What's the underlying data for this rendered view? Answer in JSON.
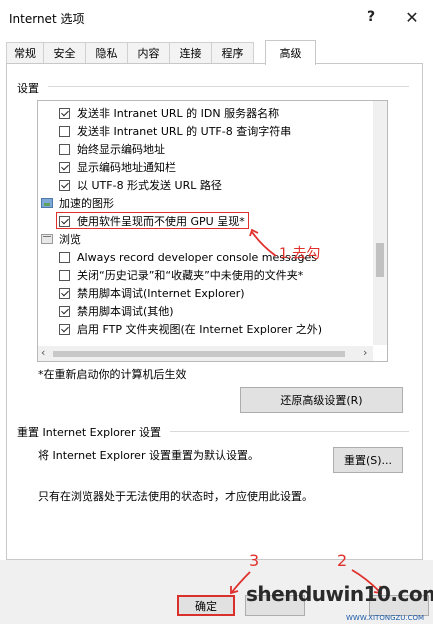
{
  "window": {
    "title": "Internet 选项",
    "help": "?",
    "close": "✕"
  },
  "tabs": [
    "常规",
    "安全",
    "隐私",
    "内容",
    "连接",
    "程序",
    "高级"
  ],
  "settings_group": "设置",
  "settings_items": [
    {
      "label": "发送非 Intranet URL 的 IDN 服务器名称",
      "checked": true
    },
    {
      "label": "发送非 Intranet URL 的 UTF-8 查询字符串",
      "checked": false
    },
    {
      "label": "始终显示编码地址",
      "checked": false
    },
    {
      "label": "显示编码地址通知栏",
      "checked": true
    },
    {
      "label": "以 UTF-8 形式发送 URL 路径",
      "checked": true
    },
    {
      "label": "加速的图形"
    },
    {
      "label": "使用软件呈现而不使用 GPU 呈现*",
      "checked": true
    },
    {
      "label": "浏览"
    },
    {
      "label": "Always record developer console messages",
      "checked": false
    },
    {
      "label": "关闭“历史记录”和“收藏夹”中未使用的文件夹*",
      "checked": false
    },
    {
      "label": "禁用脚本调试(Internet Explorer)",
      "checked": true
    },
    {
      "label": "禁用脚本调试(其他)",
      "checked": true
    },
    {
      "label": "启用 FTP 文件夹视图(在 Internet Explorer 之外)",
      "checked": true
    }
  ],
  "restart_note": "*在重新启动你的计算机后生效",
  "restore_button": "还原高级设置(R)",
  "reset": {
    "title": "重置 Internet Explorer 设置",
    "description": "将 Internet Explorer 设置重置为默认设置。",
    "button": "重置(S)...",
    "note": "只有在浏览器处于无法使用的状态时，才应使用此设置。"
  },
  "footer": {
    "ok": "确定"
  },
  "annotations": {
    "step1": "1.去勾",
    "step2": "2",
    "step3": "3",
    "color": "#e0302c"
  },
  "watermark": {
    "text": "shenduwin10.com",
    "sub": "WWW.XITONGZU.COM"
  }
}
